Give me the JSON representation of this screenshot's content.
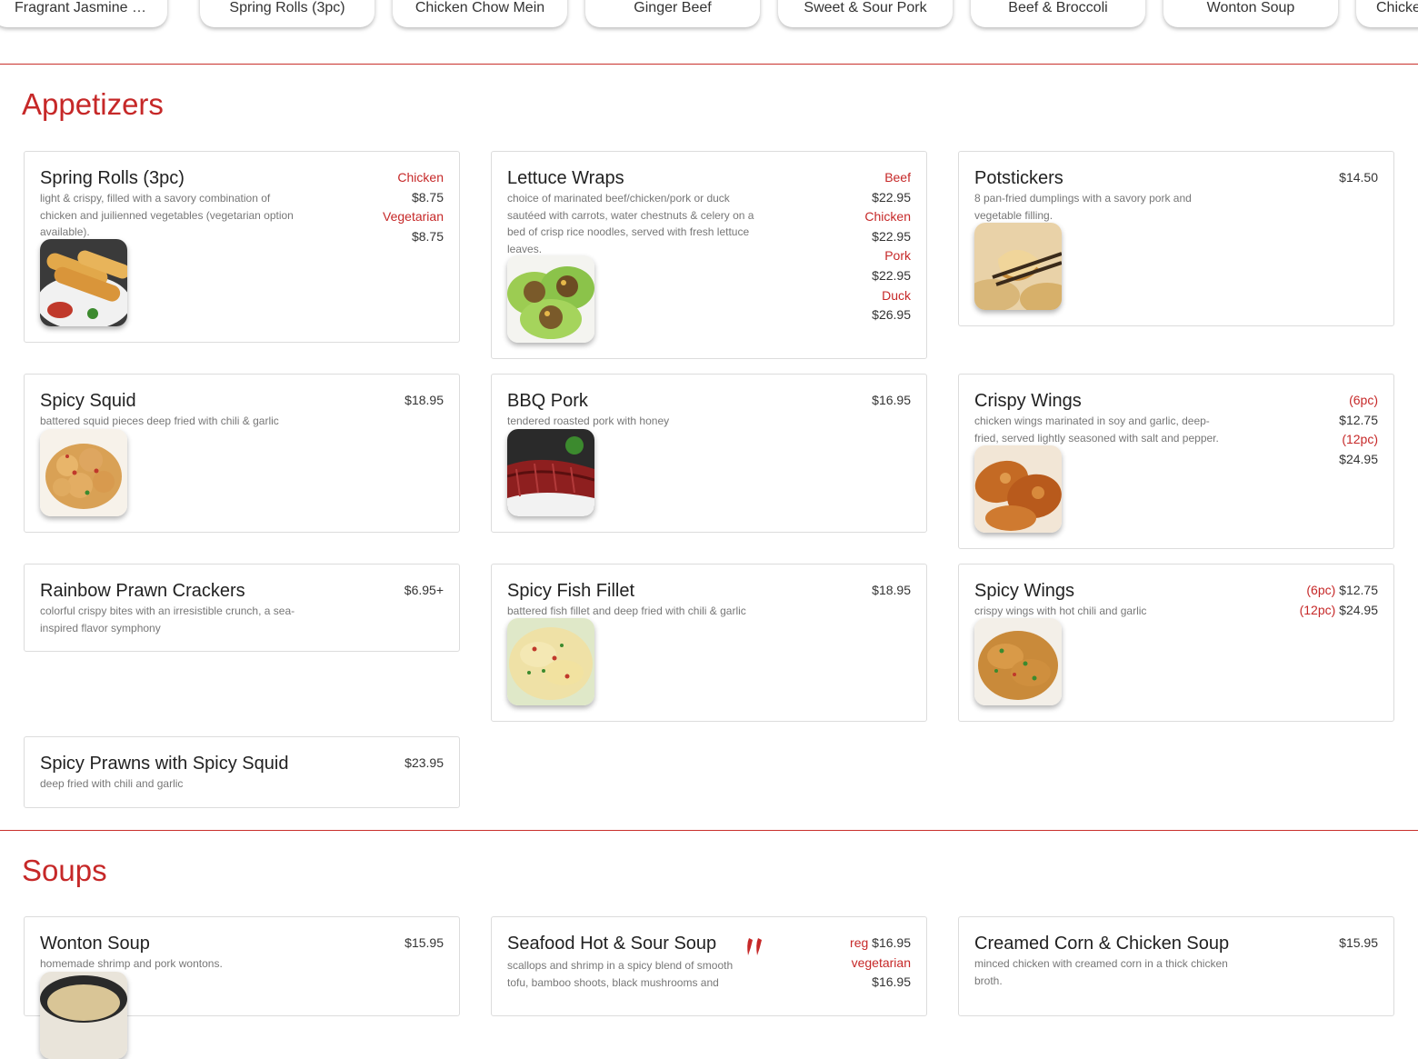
{
  "top_nav": {
    "chips": [
      "Fragrant Jasmine White Rice",
      "Spring Rolls (3pc)",
      "Chicken Chow Mein",
      "Ginger Beef",
      "Sweet & Sour Pork",
      "Beef & Broccoli",
      "Wonton Soup",
      "Chicken"
    ]
  },
  "sections": {
    "appetizers": {
      "title": "Appetizers",
      "items": [
        {
          "name": "Spring Rolls (3pc)",
          "desc": "light & crispy, filled with a savory combination of chicken and juilienned vegetables (vegetarian option available).",
          "p1_label": "Chicken",
          "p1_price": "$8.75",
          "p2_label": "Vegetarian",
          "p2_price": "$8.75",
          "image": "spring-rolls-photo"
        },
        {
          "name": "Lettuce Wraps",
          "desc": "choice of marinated beef/chicken/pork or duck sautéed with carrots, water chestnuts & celery on a bed of crisp rice noodles, served with fresh lettuce leaves.",
          "p1_label": "Beef",
          "p1_price": "$22.95",
          "p2_label": "Chicken",
          "p2_price": "$22.95",
          "p3_label": "Pork",
          "p3_price": "$22.95",
          "p4_label": "Duck",
          "p4_price": "$26.95",
          "image": "lettuce-wraps-photo"
        },
        {
          "name": "Potstickers",
          "desc": "8 pan-fried dumplings with a savory pork and vegetable filling.",
          "price": "$14.50",
          "image": "potstickers-photo"
        },
        {
          "name": "Spicy Squid",
          "desc": "battered squid pieces deep fried with chili & garlic",
          "price": "$18.95",
          "image": "spicy-squid-photo"
        },
        {
          "name": "BBQ Pork",
          "desc": "tendered roasted pork with honey",
          "price": "$16.95",
          "image": "bbq-pork-photo"
        },
        {
          "name": "Crispy Wings",
          "desc": "chicken wings marinated in soy and garlic, deep-fried, served lightly seasoned with salt and pepper.",
          "p1_label": "(6pc)",
          "p1_price": "$12.75",
          "p2_label": "(12pc)",
          "p2_price": "$24.95",
          "image": "crispy-wings-photo"
        },
        {
          "name": "Rainbow Prawn Crackers",
          "desc": "colorful crispy bites with an irresistible crunch, a sea-inspired flavor symphony",
          "price": "$6.95+"
        },
        {
          "name": "Spicy Fish Fillet",
          "desc": "battered fish fillet and deep fried with chili & garlic",
          "price": "$18.95",
          "image": "spicy-fish-fillet-photo"
        },
        {
          "name": "Spicy Wings",
          "desc": "crispy wings with hot chili and garlic",
          "p1_label": "(6pc)",
          "p1_price": "$12.75",
          "p2_label": "(12pc)",
          "p2_price": "$24.95",
          "image": "spicy-wings-photo"
        },
        {
          "name": "Spicy Prawns with Spicy Squid",
          "desc": "deep fried with chili and garlic",
          "price": "$23.95"
        }
      ]
    },
    "soups": {
      "title": "Soups",
      "items": [
        {
          "name": "Wonton Soup",
          "desc": "homemade shrimp and pork wontons.",
          "price": "$15.95",
          "image": "wonton-soup-photo"
        },
        {
          "name": "Seafood Hot & Sour Soup",
          "desc": "scallops and shrimp in a spicy blend of smooth tofu, bamboo shoots, black mushrooms and",
          "p1_label": "reg",
          "p1_price": "$16.95",
          "p2_label": "vegetarian",
          "p2_price": "$16.95",
          "icon": "chili-pepper-icon"
        },
        {
          "name": "Creamed Corn & Chicken Soup",
          "desc": "minced chicken with creamed corn in a thick chicken broth.",
          "price": "$15.95"
        }
      ]
    }
  },
  "colors": {
    "accent": "#c62828",
    "text": "#212121",
    "muted": "#777777",
    "border": "#dcdcdc"
  }
}
